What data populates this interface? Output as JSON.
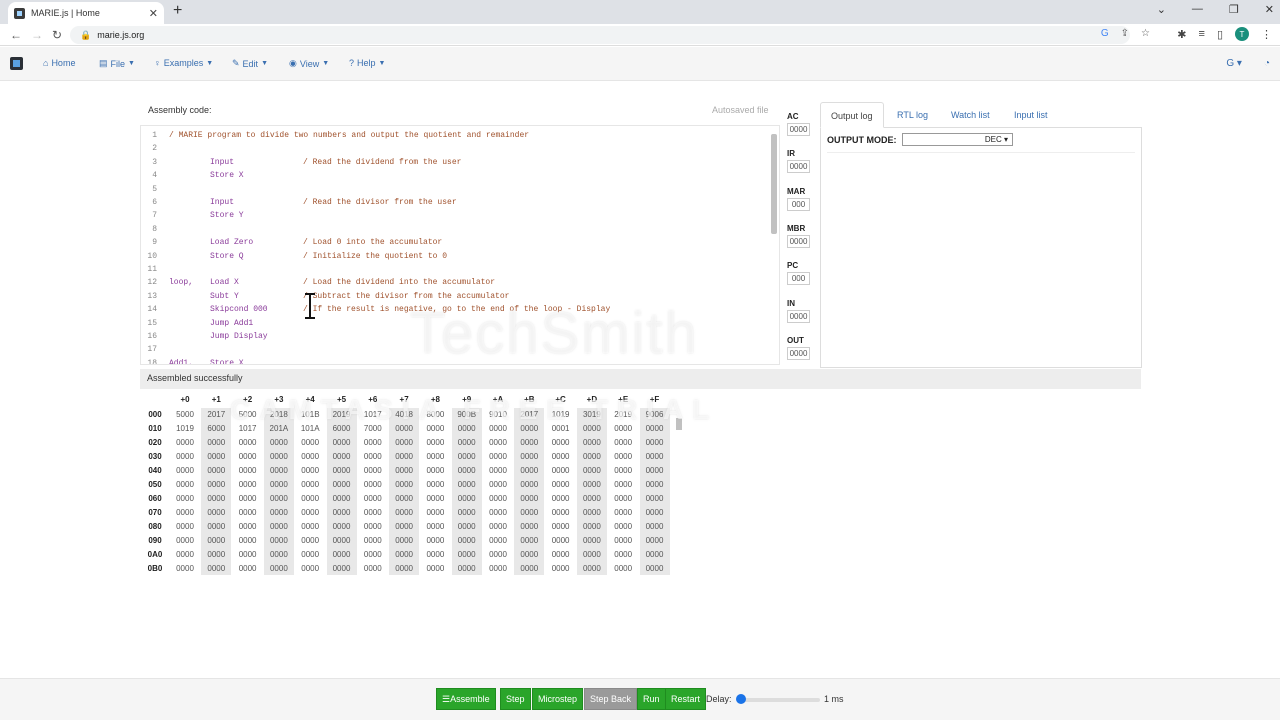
{
  "browser": {
    "tab_title": "MARIE.js | Home",
    "url": "marie.js.org"
  },
  "navbar": {
    "items": [
      {
        "icon": "home-icon",
        "label": "Home"
      },
      {
        "icon": "file-icon",
        "label": "File"
      },
      {
        "icon": "lightbulb-icon",
        "label": "Examples"
      },
      {
        "icon": "pencil-icon",
        "label": "Edit"
      },
      {
        "icon": "eye-icon",
        "label": "View"
      },
      {
        "icon": "help-icon",
        "label": "Help"
      }
    ]
  },
  "editor": {
    "label": "Assembly code:",
    "autosave": "Autosaved file",
    "lines": [
      {
        "n": "1",
        "label": "",
        "ins": "",
        "comment": "/ MARIE program to divide two numbers and output the quotient and remainder",
        "full": true
      },
      {
        "n": "2",
        "label": "",
        "ins": "",
        "comment": ""
      },
      {
        "n": "3",
        "label": "",
        "ins": "Input",
        "comment": "/ Read the dividend from the user"
      },
      {
        "n": "4",
        "label": "",
        "ins": "Store X",
        "comment": ""
      },
      {
        "n": "5",
        "label": "",
        "ins": "",
        "comment": ""
      },
      {
        "n": "6",
        "label": "",
        "ins": "Input",
        "comment": "/ Read the divisor from the user"
      },
      {
        "n": "7",
        "label": "",
        "ins": "Store Y",
        "comment": ""
      },
      {
        "n": "8",
        "label": "",
        "ins": "",
        "comment": ""
      },
      {
        "n": "9",
        "label": "",
        "ins": "Load Zero",
        "comment": "/ Load 0 into the accumulator"
      },
      {
        "n": "10",
        "label": "",
        "ins": "Store Q",
        "comment": "/ Initialize the quotient to 0"
      },
      {
        "n": "11",
        "label": "",
        "ins": "",
        "comment": ""
      },
      {
        "n": "12",
        "label": "loop,",
        "ins": "Load X",
        "comment": "/ Load the dividend into the accumulator"
      },
      {
        "n": "13",
        "label": "",
        "ins": "Subt Y",
        "comment": "/ Subtract the divisor from the accumulator"
      },
      {
        "n": "14",
        "label": "",
        "ins": "Skipcond 000",
        "comment": "/ If the result is negative, go to the end of the loop - Display"
      },
      {
        "n": "15",
        "label": "",
        "ins": "Jump Add1",
        "comment": ""
      },
      {
        "n": "16",
        "label": "",
        "ins": "Jump Display",
        "comment": ""
      },
      {
        "n": "17",
        "label": "",
        "ins": "",
        "comment": ""
      },
      {
        "n": "18",
        "label": "Add1,",
        "ins": "Store X",
        "comment": ""
      }
    ]
  },
  "registers": [
    {
      "name": "AC",
      "value": "0000"
    },
    {
      "name": "IR",
      "value": "0000"
    },
    {
      "name": "MAR",
      "value": "000"
    },
    {
      "name": "MBR",
      "value": "0000"
    },
    {
      "name": "PC",
      "value": "000"
    },
    {
      "name": "IN",
      "value": "0000"
    },
    {
      "name": "OUT",
      "value": "0000"
    }
  ],
  "right_tabs": [
    "Output log",
    "RTL log",
    "Watch list",
    "Input list"
  ],
  "output": {
    "mode_label": "OUTPUT MODE:",
    "mode_value": "DEC"
  },
  "status": "Assembled successfully",
  "memory": {
    "columns": [
      "+0",
      "+1",
      "+2",
      "+3",
      "+4",
      "+5",
      "+6",
      "+7",
      "+8",
      "+9",
      "+A",
      "+B",
      "+C",
      "+D",
      "+E",
      "+F"
    ],
    "rows": [
      {
        "addr": "000",
        "cells": [
          "5000",
          "2017",
          "5000",
          "2018",
          "101B",
          "2019",
          "1017",
          "4018",
          "8000",
          "900B",
          "9010",
          "2017",
          "1019",
          "3019",
          "2019",
          "9006"
        ]
      },
      {
        "addr": "010",
        "cells": [
          "1019",
          "6000",
          "1017",
          "201A",
          "101A",
          "6000",
          "7000",
          "0000",
          "0000",
          "0000",
          "0000",
          "0000",
          "0001",
          "0000",
          "0000",
          "0000"
        ]
      },
      {
        "addr": "020",
        "cells": [
          "0000",
          "0000",
          "0000",
          "0000",
          "0000",
          "0000",
          "0000",
          "0000",
          "0000",
          "0000",
          "0000",
          "0000",
          "0000",
          "0000",
          "0000",
          "0000"
        ]
      },
      {
        "addr": "030",
        "cells": [
          "0000",
          "0000",
          "0000",
          "0000",
          "0000",
          "0000",
          "0000",
          "0000",
          "0000",
          "0000",
          "0000",
          "0000",
          "0000",
          "0000",
          "0000",
          "0000"
        ]
      },
      {
        "addr": "040",
        "cells": [
          "0000",
          "0000",
          "0000",
          "0000",
          "0000",
          "0000",
          "0000",
          "0000",
          "0000",
          "0000",
          "0000",
          "0000",
          "0000",
          "0000",
          "0000",
          "0000"
        ]
      },
      {
        "addr": "050",
        "cells": [
          "0000",
          "0000",
          "0000",
          "0000",
          "0000",
          "0000",
          "0000",
          "0000",
          "0000",
          "0000",
          "0000",
          "0000",
          "0000",
          "0000",
          "0000",
          "0000"
        ]
      },
      {
        "addr": "060",
        "cells": [
          "0000",
          "0000",
          "0000",
          "0000",
          "0000",
          "0000",
          "0000",
          "0000",
          "0000",
          "0000",
          "0000",
          "0000",
          "0000",
          "0000",
          "0000",
          "0000"
        ]
      },
      {
        "addr": "070",
        "cells": [
          "0000",
          "0000",
          "0000",
          "0000",
          "0000",
          "0000",
          "0000",
          "0000",
          "0000",
          "0000",
          "0000",
          "0000",
          "0000",
          "0000",
          "0000",
          "0000"
        ]
      },
      {
        "addr": "080",
        "cells": [
          "0000",
          "0000",
          "0000",
          "0000",
          "0000",
          "0000",
          "0000",
          "0000",
          "0000",
          "0000",
          "0000",
          "0000",
          "0000",
          "0000",
          "0000",
          "0000"
        ]
      },
      {
        "addr": "090",
        "cells": [
          "0000",
          "0000",
          "0000",
          "0000",
          "0000",
          "0000",
          "0000",
          "0000",
          "0000",
          "0000",
          "0000",
          "0000",
          "0000",
          "0000",
          "0000",
          "0000"
        ]
      },
      {
        "addr": "0A0",
        "cells": [
          "0000",
          "0000",
          "0000",
          "0000",
          "0000",
          "0000",
          "0000",
          "0000",
          "0000",
          "0000",
          "0000",
          "0000",
          "0000",
          "0000",
          "0000",
          "0000"
        ]
      },
      {
        "addr": "0B0",
        "cells": [
          "0000",
          "0000",
          "0000",
          "0000",
          "0000",
          "0000",
          "0000",
          "0000",
          "0000",
          "0000",
          "0000",
          "0000",
          "0000",
          "0000",
          "0000",
          "0000"
        ]
      }
    ]
  },
  "controls": {
    "assemble": "Assemble",
    "step": "Step",
    "microstep": "Microstep",
    "step_back": "Step Back",
    "run": "Run",
    "restart": "Restart",
    "delay_label": "Delay:",
    "delay_value": "1 ms"
  },
  "watermark": {
    "brand": "TechSmith",
    "trial": "CAMTASIA FREE TRIAL"
  },
  "colors": {
    "button_green": "#2aa52a",
    "link_blue": "#3a6fb0",
    "comment": "#a0522d",
    "keyword": "#8a3b9a"
  }
}
